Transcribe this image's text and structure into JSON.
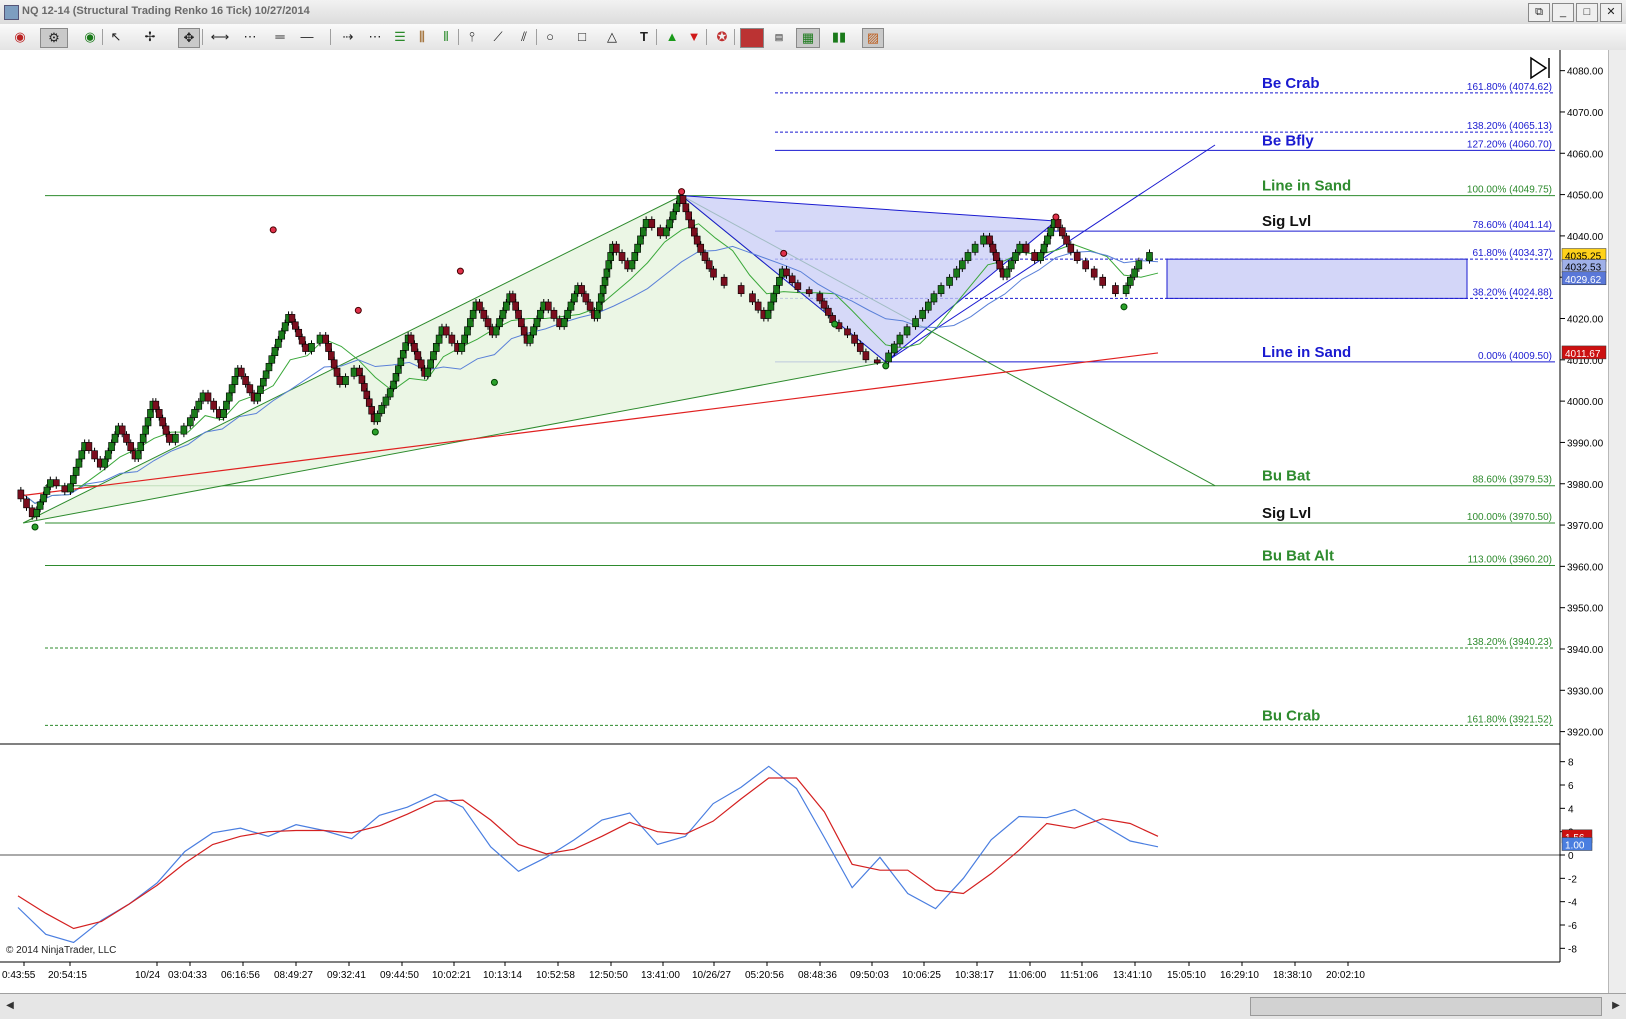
{
  "window": {
    "title": "NQ 12-14 (Structural Trading Renko 16 Tick)  10/27/2014",
    "buttons": [
      "⧉",
      "_",
      "□",
      "✕"
    ]
  },
  "toolbar": {
    "icons": [
      "eye-icon",
      "instrument-icon",
      "data-eye-icon",
      "pointer-icon",
      "crosshair-icon",
      "pan-icon",
      "bar-spacing-icon",
      "line-style-icon",
      "line-width-icon",
      "draw-line-icon",
      "ray-icon",
      "fib-retracement-icon",
      "fib-extension-icon",
      "fib-time-icon",
      "andrews-pitchfork-icon",
      "gann-fan-icon",
      "regression-channel-icon",
      "ellipse-icon",
      "rectangle-icon",
      "triangle-icon",
      "text-icon",
      "arrow-up-icon",
      "arrow-down-icon",
      "misc-draw-icon",
      "chart-trader-icon",
      "data-box-icon",
      "indicators-icon",
      "strategies-icon",
      "properties-icon"
    ]
  },
  "colors": {
    "bull_candle": "#1a7a1a",
    "bear_candle": "#7a0e1e",
    "green_line": "#2e8b2e",
    "blue_line": "#1a1ad0",
    "red_ma": "#e02020",
    "zone_fill": "#c8ccf6",
    "pattern_green_fill": "#e6f4de"
  },
  "copyright": "© 2014 NinjaTrader, LLC",
  "chart_data": [
    {
      "type": "candlestick",
      "subtype": "renko",
      "title": "",
      "ylim": [
        3917,
        4085
      ],
      "yticks": [
        4080,
        4070,
        4060,
        4050,
        4040,
        4030,
        4020,
        4010,
        4000,
        3990,
        3980,
        3970,
        3960,
        3950,
        3940,
        3930,
        3920
      ],
      "ytick_labels": [
        "4080.00",
        "4070.00",
        "4060.00",
        "4050.00",
        "4040.00",
        "4030.00",
        "4020.00",
        "4010.00",
        "4000.00",
        "3990.00",
        "3980.00",
        "3970.00",
        "3960.00",
        "3950.00",
        "3940.00",
        "3930.00",
        "3920.00"
      ],
      "xtick_labels": [
        "0:43:55",
        "20:54:15",
        "10/24",
        "03:04:33",
        "06:16:56",
        "08:49:27",
        "09:32:41",
        "09:44:50",
        "10:02:21",
        "10:13:14",
        "10:52:58",
        "12:50:50",
        "13:41:00",
        "10/26/27",
        "05:20:56",
        "08:48:36",
        "09:50:03",
        "10:06:25",
        "10:38:17",
        "11:06:00",
        "11:51:06",
        "13:41:10",
        "15:05:10",
        "16:29:10",
        "18:38:10",
        "20:02:10"
      ],
      "price_path": [
        3978.5,
        3972,
        3981,
        3978,
        3990,
        3984,
        3994,
        3986,
        4000,
        3990,
        3994,
        4002,
        3996,
        4008,
        4000,
        4011,
        4021,
        4012,
        4016,
        4004,
        4008,
        3995,
        4003,
        4016,
        4006,
        4018,
        4012,
        4024,
        4016,
        4026,
        4014,
        4024,
        4018,
        4028,
        4020,
        4038,
        4032,
        4044,
        4040,
        4049.75,
        4038,
        4030,
        4028,
        4026,
        4020,
        4032,
        4027,
        4026,
        4019,
        4016,
        4010,
        4009.5,
        4016,
        4020,
        4026,
        4030,
        4036,
        4040,
        4030,
        4038,
        4034,
        4044,
        4036,
        4032,
        4028,
        4026,
        4034,
        4036
      ],
      "swing_points": {
        "highs": [
          4040.5,
          4021,
          4030.5,
          4049.75,
          4034.8,
          4043.6
        ],
        "lows": [
          3970.5,
          3993.5,
          4005.5,
          4019.6,
          4009.5,
          4023.8
        ]
      },
      "levels": [
        {
          "label": "Be Crab",
          "ratio": "161.80% (4074.62)",
          "value": 4074.62,
          "color": "#1a1ad0",
          "dashed": true
        },
        {
          "label": "",
          "ratio": "138.20% (4065.13)",
          "value": 4065.13,
          "color": "#1a1ad0",
          "dashed": true
        },
        {
          "label": "Be Bfly",
          "ratio": "127.20% (4060.70)",
          "value": 4060.7,
          "color": "#1a1ad0",
          "dashed": false
        },
        {
          "label": "Line in Sand",
          "ratio": "100.00% (4049.75)",
          "value": 4049.75,
          "color": "#2e8b2e",
          "dashed": false
        },
        {
          "label": "Sig Lvl",
          "ratio": "78.60% (4041.14)",
          "value": 4041.14,
          "color": "#1a1ad0",
          "dashed": false
        },
        {
          "label": "",
          "ratio": "61.80% (4034.37)",
          "value": 4034.37,
          "color": "#1a1ad0",
          "dashed": true
        },
        {
          "label": "",
          "ratio": "38.20% (4024.88)",
          "value": 4024.88,
          "color": "#1a1ad0",
          "dashed": true
        },
        {
          "label": "Line in Sand",
          "ratio": "0.00% (4009.50)",
          "value": 4009.5,
          "color": "#1a1ad0",
          "dashed": false
        },
        {
          "label": "Bu Bat",
          "ratio": "88.60% (3979.53)",
          "value": 3979.53,
          "color": "#2e8b2e",
          "dashed": false
        },
        {
          "label": "Sig Lvl",
          "ratio": "100.00% (3970.50)",
          "value": 3970.5,
          "color": "#2e8b2e",
          "dashed": false
        },
        {
          "label": "Bu Bat Alt",
          "ratio": "113.00% (3960.20)",
          "value": 3960.2,
          "color": "#2e8b2e",
          "dashed": false
        },
        {
          "label": "",
          "ratio": "138.20% (3940.23)",
          "value": 3940.23,
          "color": "#2e8b2e",
          "dashed": true
        },
        {
          "label": "Bu Crab",
          "ratio": "161.80% (3921.52)",
          "value": 3921.52,
          "color": "#2e8b2e",
          "dashed": true
        }
      ],
      "price_tags": [
        {
          "text": "4035.25",
          "value": 4035.25,
          "bg": "#ffd21a",
          "fg": "#000000"
        },
        {
          "text": "4032.53",
          "value": 4032.6,
          "bg": "#9fb0e8",
          "fg": "#000000"
        },
        {
          "text": "4029.62",
          "value": 4029.62,
          "bg": "#5a78d8",
          "fg": "#ffffff"
        },
        {
          "text": "4011.67",
          "value": 4011.67,
          "bg": "#cc1010",
          "fg": "#ffffff"
        }
      ]
    },
    {
      "type": "line",
      "title": "",
      "ylim": [
        -9,
        9
      ],
      "yticks": [
        8,
        6,
        4,
        2,
        0,
        -2,
        -4,
        -6,
        -8
      ],
      "ytick_labels": [
        "8",
        "6",
        "4",
        "2",
        "0",
        "-2",
        "-4",
        "-6",
        "-8"
      ],
      "series": [
        {
          "color": "#4a7ee0",
          "values": [
            -4.5,
            -6.8,
            -7.5,
            -5.6,
            -4.2,
            -2.4,
            0.3,
            1.9,
            2.3,
            1.6,
            2.6,
            2.1,
            1.4,
            3.4,
            4.1,
            5.2,
            4.1,
            0.7,
            -1.4,
            -0.2,
            1.3,
            3.0,
            3.6,
            0.9,
            1.6,
            4.4,
            5.8,
            7.6,
            5.7,
            1.5,
            -2.8,
            -0.2,
            -3.3,
            -4.6,
            -2.0,
            1.3,
            3.3,
            3.2,
            3.9,
            2.6,
            1.2,
            0.7
          ]
        },
        {
          "color": "#d42020",
          "values": [
            -3.5,
            -5.0,
            -6.3,
            -5.7,
            -4.2,
            -2.6,
            -0.7,
            0.9,
            1.6,
            2.0,
            2.1,
            2.1,
            1.9,
            2.5,
            3.5,
            4.6,
            4.7,
            3.0,
            0.9,
            0.1,
            0.5,
            1.6,
            2.8,
            2.0,
            1.8,
            2.9,
            4.8,
            6.6,
            6.6,
            3.7,
            -0.8,
            -1.3,
            -1.3,
            -3.0,
            -3.3,
            -1.6,
            0.4,
            2.7,
            2.3,
            3.1,
            2.7,
            1.6
          ]
        }
      ],
      "price_tags": [
        {
          "text": "1.56",
          "value": 1.56,
          "bg": "#cc1010",
          "fg": "#ffffff"
        },
        {
          "text": "1.00",
          "value": 0.9,
          "bg": "#4a7ee0",
          "fg": "#ffffff"
        }
      ]
    }
  ]
}
